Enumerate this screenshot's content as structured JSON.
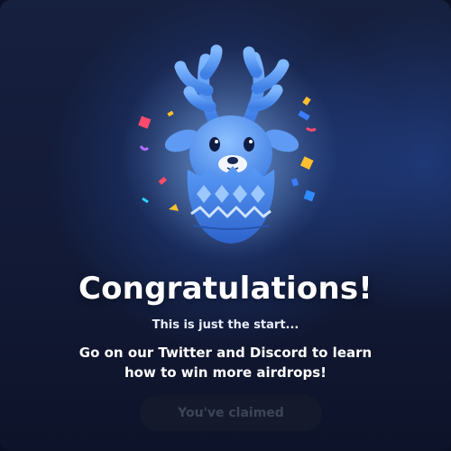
{
  "modal": {
    "title": "Congratulations!",
    "subtitle": "This is just the start...",
    "message": "Go on our Twitter and Discord to learn how to win more airdrops!",
    "claim_button_label": "You've claimed",
    "claim_button_state": "disabled"
  },
  "illustration": {
    "icon": "reindeer-egg-mascot-icon",
    "confetti": "confetti-icon"
  },
  "colors": {
    "background": "#121a36",
    "mascot_blue": "#4f8ff2",
    "button_bg": "#141a2c",
    "button_text": "#3d4457"
  }
}
